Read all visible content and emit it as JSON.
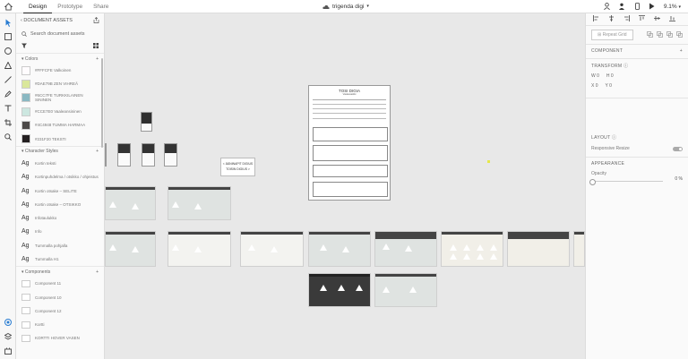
{
  "topbar": {
    "tabs": [
      "Design",
      "Prototype",
      "Share"
    ],
    "active_tab": "Design",
    "doc_title": "trigenda digi",
    "zoom": "9.1%"
  },
  "assets": {
    "header": "DOCUMENT ASSETS",
    "search_placeholder": "Search document assets",
    "colors_title": "Colors",
    "colors": [
      {
        "name": "#FFFCFE Valkoinen",
        "hex": "#fffcfe"
      },
      {
        "name": "#DAE79B ZEN VIHREÄ",
        "hex": "#dae79b"
      },
      {
        "name": "#6CC7FE TURKKILAINEN SININEN",
        "hex": "#8ab8c2"
      },
      {
        "name": "#CCE7E0 Vaaleansininen",
        "hex": "#cce7e0"
      },
      {
        "name": "#4C4948 TUMMA HARMAA",
        "hex": "#4c4948"
      },
      {
        "name": "#231F20 TEKSTI",
        "hex": "#231f20"
      }
    ],
    "char_styles_title": "Character Styles",
    "char_styles": [
      "Kortin teksti",
      "Kortinpuhdelma / otsikko / ohjeistus",
      "Kortin otsake – SELITE",
      "Kortin otsake – OTSIKKO",
      "Infotaulukko",
      "Info",
      "Tummalla pohjalla",
      "Tummalla H1"
    ],
    "components_title": "Components",
    "components": [
      "Component 11",
      "Component 10",
      "Component 12",
      "Kortti",
      "KORTTI HOVER VASEN"
    ]
  },
  "canvas": {
    "popup_lines": [
      "< ÄÄNINAPIT DIGIUS",
      "TOISIN DIGIUS >"
    ],
    "form_title": "TOSI DIGIA",
    "form_subtitle": "Vastausarkki"
  },
  "props": {
    "repeat_grid": "Repeat Grid",
    "component": "COMPONENT",
    "transform": "TRANSFORM",
    "w": "W",
    "w_val": "0",
    "h": "H",
    "h_val": "0",
    "x": "X",
    "x_val": "0",
    "y": "Y",
    "y_val": "0",
    "layout": "LAYOUT",
    "responsive_resize": "Responsive Resize",
    "appearance": "APPEARANCE",
    "opacity": "Opacity",
    "opacity_val": "0 %"
  }
}
